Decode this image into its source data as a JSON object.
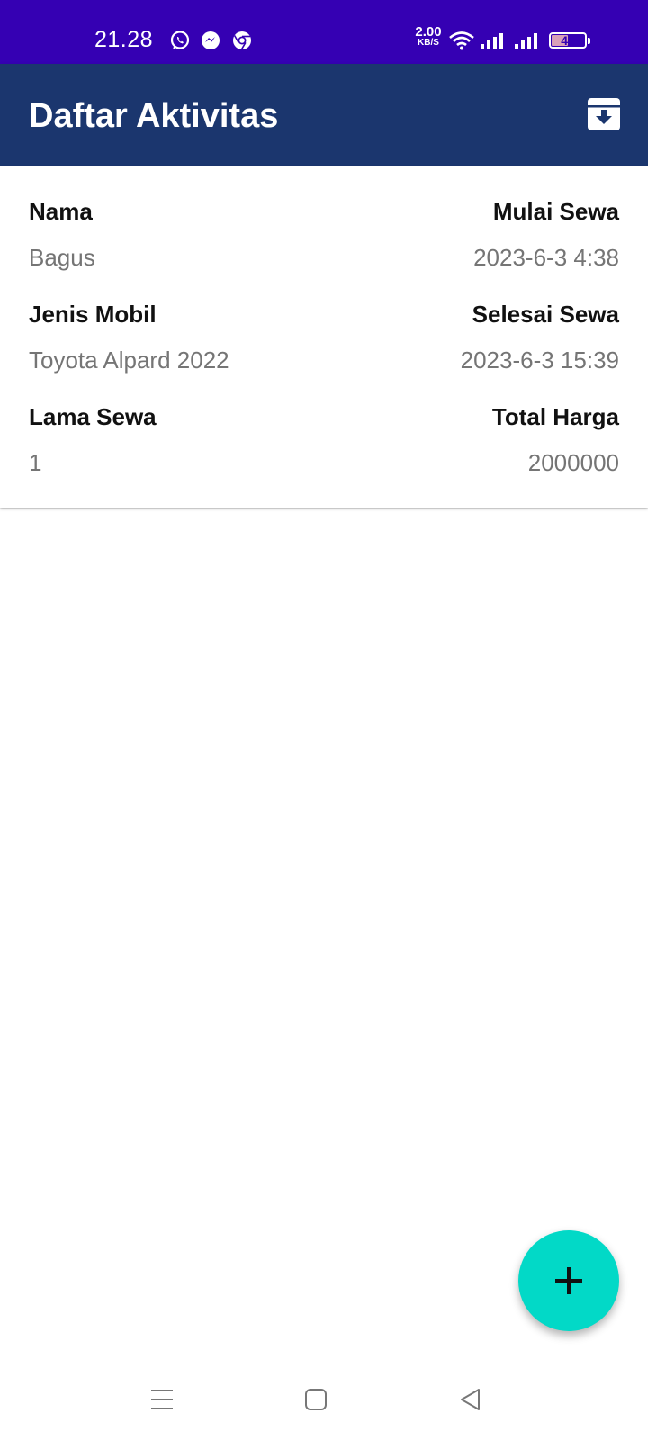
{
  "status_bar": {
    "time": "21.28",
    "net_speed_value": "2.00",
    "net_speed_unit": "KB/S",
    "battery_level": "49",
    "icons": [
      "whatsapp-icon",
      "messenger-icon",
      "chrome-icon",
      "wifi-icon",
      "signal-icon",
      "signal-icon",
      "battery-icon"
    ]
  },
  "app_bar": {
    "title": "Daftar Aktivitas",
    "action_icon": "archive-download-icon"
  },
  "colors": {
    "status_bar": "#3500b3",
    "app_bar": "#1b366e",
    "fab": "#02d9c7",
    "value_text": "#757575"
  },
  "activity": {
    "nama_label": "Nama",
    "nama_value": "Bagus",
    "mulai_sewa_label": "Mulai Sewa",
    "mulai_sewa_value": "2023-6-3 4:38",
    "jenis_mobil_label": "Jenis Mobil",
    "jenis_mobil_value": "Toyota Alpard 2022",
    "selesai_sewa_label": "Selesai Sewa",
    "selesai_sewa_value": "2023-6-3 15:39",
    "lama_sewa_label": "Lama Sewa",
    "lama_sewa_value": "1",
    "total_harga_label": "Total Harga",
    "total_harga_value": "2000000"
  },
  "fab": {
    "icon": "plus-icon"
  },
  "nav_bar": {
    "icons": [
      "menu-icon",
      "home-icon",
      "back-icon"
    ]
  }
}
